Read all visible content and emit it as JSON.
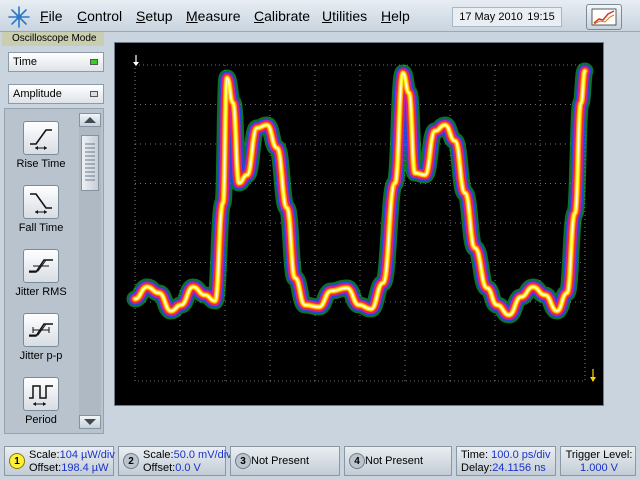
{
  "menu": {
    "items": [
      {
        "underline": "F",
        "rest": "ile"
      },
      {
        "underline": "C",
        "rest": "ontrol"
      },
      {
        "underline": "S",
        "rest": "etup"
      },
      {
        "underline": "M",
        "rest": "easure"
      },
      {
        "underline": "C",
        "rest": "alibrate"
      },
      {
        "underline": "U",
        "rest": "tilities"
      },
      {
        "underline": "H",
        "rest": "elp"
      }
    ],
    "date": "17 May 2010",
    "time": "19:15"
  },
  "left_panel": {
    "mode_label": "Oscilloscope Mode",
    "time_button": "Time",
    "amplitude_button": "Amplitude",
    "measurements": [
      {
        "label": "Rise Time",
        "icon": "rise-time-icon"
      },
      {
        "label": "Fall Time",
        "icon": "fall-time-icon"
      },
      {
        "label": "Jitter RMS",
        "icon": "jitter-rms-icon"
      },
      {
        "label": "Jitter p-p",
        "icon": "jitter-pp-icon"
      },
      {
        "label": "Period",
        "icon": "period-icon"
      }
    ]
  },
  "status": {
    "ch1": {
      "number": "1",
      "scale_label": "Scale:",
      "scale_value": "104 µW/div",
      "offset_label": "Offset:",
      "offset_value": "198.4 µW"
    },
    "ch2": {
      "number": "2",
      "scale_label": "Scale:",
      "scale_value": "50.0 mV/div",
      "offset_label": "Offset:",
      "offset_value": "0.0 V"
    },
    "ch3": {
      "number": "3",
      "text": "Not Present"
    },
    "ch4": {
      "number": "4",
      "text": "Not Present"
    },
    "timebase": {
      "time_label": "Time:",
      "time_value": "100.0 ps/div",
      "delay_label": "Delay:",
      "delay_value": "24.1156 ns"
    },
    "trigger": {
      "label": "Trigger Level:",
      "value": "1.000 V"
    }
  },
  "colors": {
    "led_green": "#33d11c",
    "trace_green": "#18d23a",
    "trace_blue": "#2840ff",
    "trace_magenta": "#e01a9a",
    "trace_red": "#ff2a12",
    "trace_orange": "#ff9a12",
    "trace_yellow": "#fff20c",
    "trace_white": "#ffffff",
    "grid": "#9a9a9a",
    "marker_white": "#ffffff",
    "marker_yellow": "#ffd400"
  }
}
